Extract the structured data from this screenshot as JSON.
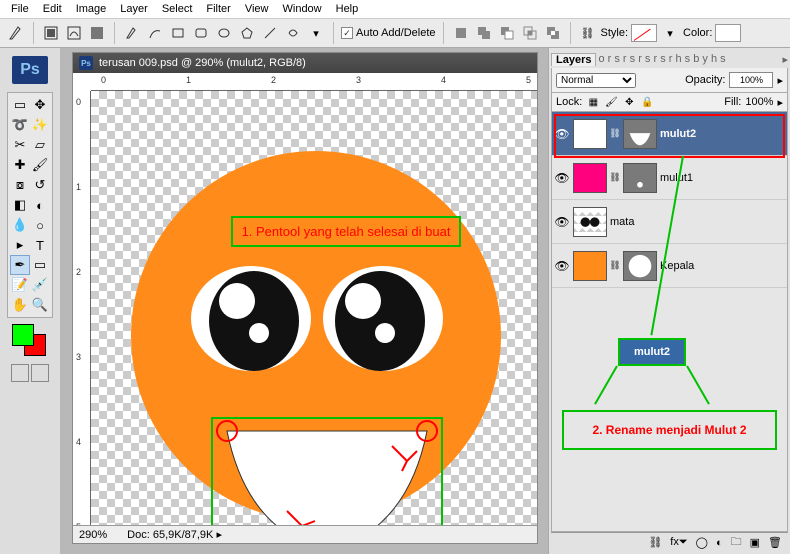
{
  "menu": {
    "items": [
      "File",
      "Edit",
      "Image",
      "Layer",
      "Select",
      "Filter",
      "View",
      "Window",
      "Help"
    ]
  },
  "optbar": {
    "auto_add_delete": "Auto Add/Delete",
    "style_label": "Style:",
    "color_label": "Color:"
  },
  "pslogo": "Ps",
  "doc": {
    "title": "terusan 009.psd @ 290% (mulut2, RGB/8)",
    "zoom": "290%",
    "docsize_label": "Doc:",
    "docsize": "65,9K/87,9K",
    "ruler_h": [
      "0",
      "1",
      "2",
      "3",
      "4",
      "5"
    ],
    "ruler_v": [
      "0",
      "1",
      "2",
      "3",
      "4",
      "5"
    ]
  },
  "annotations": {
    "a1": "1. Pentool yang telah selesai di buat",
    "mulut2_badge": "mulut2",
    "a2": "2. Rename menjadi Mulut 2"
  },
  "panels": {
    "tab": "Layers",
    "tab_others": "o r s r s r s r s r h s b y h s",
    "blend_mode": "Normal",
    "opacity_label": "Opacity:",
    "opacity": "100%",
    "lock_label": "Lock:",
    "fill_label": "Fill:",
    "fill": "100%",
    "layers": [
      {
        "name": "mulut2",
        "thumb_bg": "#ffffff",
        "mask_shape": "mouth",
        "selected": true
      },
      {
        "name": "mulut1",
        "thumb_bg": "#ff007f",
        "mask_shape": "dot",
        "selected": false
      },
      {
        "name": "mata",
        "thumb_bg": "transp",
        "mask_shape": "",
        "selected": false
      },
      {
        "name": "Kepala",
        "thumb_bg": "#ff8c1a",
        "mask_shape": "circle",
        "selected": false
      }
    ]
  },
  "colors": {
    "fg": "#00ff00",
    "bg": "#ff0000",
    "face": "#ff8c1a",
    "sel_layer": "#4a6a9a",
    "annot_green": "#00c000",
    "annot_red": "#ff0000"
  }
}
